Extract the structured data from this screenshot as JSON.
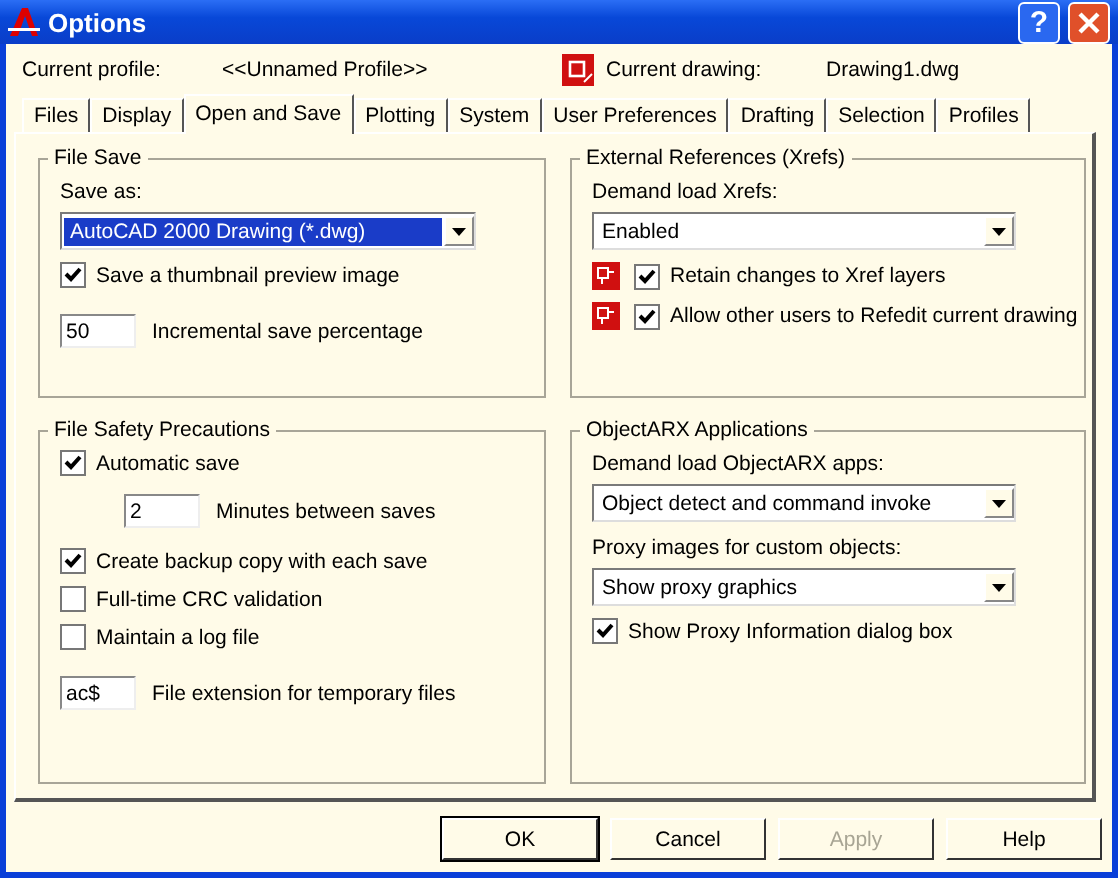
{
  "window": {
    "title": "Options",
    "help": "?"
  },
  "profile": {
    "label": "Current profile:",
    "value": "<<Unnamed Profile>>"
  },
  "drawing": {
    "label": "Current drawing:",
    "value": "Drawing1.dwg"
  },
  "tabs": [
    {
      "label": "Files",
      "selected": false
    },
    {
      "label": "Display",
      "selected": false
    },
    {
      "label": "Open and Save",
      "selected": true
    },
    {
      "label": "Plotting",
      "selected": false
    },
    {
      "label": "System",
      "selected": false
    },
    {
      "label": "User Preferences",
      "selected": false
    },
    {
      "label": "Drafting",
      "selected": false
    },
    {
      "label": "Selection",
      "selected": false
    },
    {
      "label": "Profiles",
      "selected": false
    }
  ],
  "groups": [
    {
      "title": "File Save",
      "rows": [
        {
          "kind": "label",
          "text": "Save as:"
        },
        {
          "kind": "select",
          "value": "AutoCAD 2000 Drawing (*.dwg)",
          "focused": true
        },
        {
          "kind": "checkbox",
          "label": "Save a thumbnail preview image",
          "checked": true
        },
        {
          "kind": "input",
          "caption": "Incremental save percentage",
          "value": "50"
        }
      ]
    },
    {
      "title": "External References (Xrefs)",
      "rows": [
        {
          "kind": "label",
          "text": "Demand load Xrefs:"
        },
        {
          "kind": "select",
          "value": "Enabled",
          "focused": false
        },
        {
          "kind": "iconcheck",
          "label": "Retain changes to Xref layers",
          "checked": true
        },
        {
          "kind": "iconcheck",
          "label": "Allow other users to Refedit current drawing",
          "checked": true
        }
      ]
    },
    {
      "title": "File Safety Precautions",
      "rows": [
        {
          "kind": "checkbox",
          "label": "Automatic save",
          "checked": true
        },
        {
          "kind": "subinput",
          "caption": "Minutes between saves",
          "value": "2"
        },
        {
          "kind": "checkbox",
          "label": "Create backup copy with each save",
          "checked": true
        },
        {
          "kind": "checkbox",
          "label": "Full-time CRC validation",
          "checked": false
        },
        {
          "kind": "checkbox",
          "label": "Maintain a log file",
          "checked": false
        },
        {
          "kind": "input",
          "caption": "File extension for temporary files",
          "value": "ac$"
        }
      ]
    },
    {
      "title": "ObjectARX Applications",
      "rows": [
        {
          "kind": "label",
          "text": "Demand load ObjectARX apps:"
        },
        {
          "kind": "select",
          "value": "Object detect and command invoke",
          "focused": false
        },
        {
          "kind": "label",
          "text": "Proxy images for custom objects:"
        },
        {
          "kind": "select",
          "value": "Show proxy graphics",
          "focused": false
        },
        {
          "kind": "checkbox",
          "label": "Show Proxy Information dialog box",
          "checked": true
        }
      ]
    }
  ],
  "buttons": [
    {
      "label": "OK",
      "default": true,
      "disabled": false
    },
    {
      "label": "Cancel",
      "default": false,
      "disabled": false
    },
    {
      "label": "Apply",
      "default": false,
      "disabled": true
    },
    {
      "label": "Help",
      "default": false,
      "disabled": false
    }
  ]
}
